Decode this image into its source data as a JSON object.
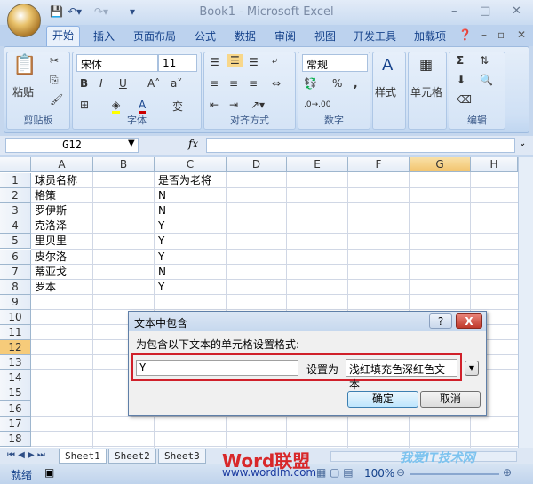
{
  "window": {
    "title": "Book1 - Microsoft Excel"
  },
  "quick_access": {
    "save_icon": "save-icon",
    "undo_icon": "undo-icon",
    "redo_icon": "redo-icon"
  },
  "tabs": [
    "开始",
    "插入",
    "页面布局",
    "公式",
    "数据",
    "审阅",
    "视图",
    "开发工具",
    "加载项"
  ],
  "ribbon": {
    "clipboard": {
      "label": "剪贴板",
      "paste": "粘贴"
    },
    "font": {
      "label": "字体",
      "font_name": "宋体",
      "font_size": "11",
      "bold": "B",
      "italic": "I",
      "underline": "U",
      "font_color": "#cc0000",
      "fill_color": "#ffff00",
      "phonetic": "变"
    },
    "alignment": {
      "label": "对齐方式"
    },
    "number": {
      "label": "数字",
      "format": "常规",
      "percent": "%",
      "comma": ","
    },
    "styles": {
      "label": "样式"
    },
    "cells": {
      "label": "单元格"
    },
    "editing": {
      "label": "编辑",
      "sum": "Σ"
    }
  },
  "formula_bar": {
    "name_box": "G12",
    "fx": "fx",
    "value": ""
  },
  "columns": [
    "A",
    "B",
    "C",
    "D",
    "E",
    "F",
    "G",
    "H"
  ],
  "selected_column": "G",
  "rows": [
    "1",
    "2",
    "3",
    "4",
    "5",
    "6",
    "7",
    "8",
    "9",
    "10",
    "11",
    "12",
    "13",
    "14",
    "15",
    "16",
    "17",
    "18"
  ],
  "selected_row": "12",
  "cells": [
    [
      "球员名称",
      "",
      "是否为老将"
    ],
    [
      "格策",
      "",
      "N"
    ],
    [
      "罗伊斯",
      "",
      "N"
    ],
    [
      "克洛泽",
      "",
      "Y"
    ],
    [
      "里贝里",
      "",
      "Y"
    ],
    [
      "皮尔洛",
      "",
      "Y"
    ],
    [
      "蒂亚戈",
      "",
      "N"
    ],
    [
      "罗本",
      "",
      "Y"
    ]
  ],
  "sheets": [
    "Sheet1",
    "Sheet2",
    "Sheet3"
  ],
  "status": {
    "ready": "就绪",
    "zoom": "100%"
  },
  "dialog": {
    "title": "文本中包含",
    "prompt": "为包含以下文本的单元格设置格式:",
    "input_value": "Y",
    "set_as_label": "设置为",
    "format_value": "浅红填充色深红色文本",
    "ok": "确定",
    "cancel": "取消",
    "help": "?",
    "close": "X",
    "highlight_color": "#d0202a"
  },
  "watermarks": {
    "brand": "Word联盟",
    "url": "www.wordlm.com",
    "site": "我爱IT技术网"
  }
}
